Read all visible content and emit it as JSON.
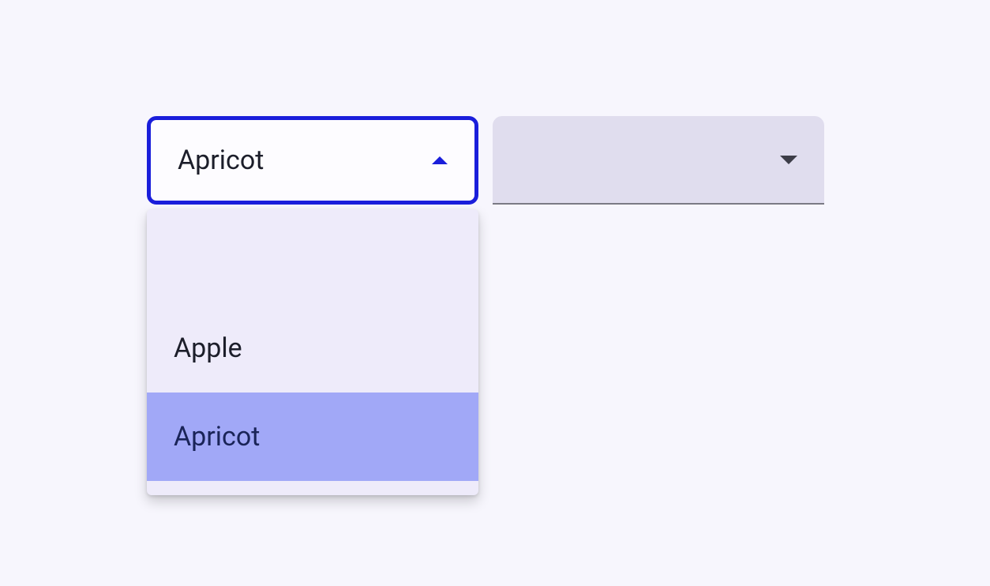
{
  "select1": {
    "value": "Apricot",
    "options": [
      {
        "label": "Apple",
        "selected": false
      },
      {
        "label": "Apricot",
        "selected": true
      }
    ]
  },
  "select2": {
    "value": ""
  }
}
